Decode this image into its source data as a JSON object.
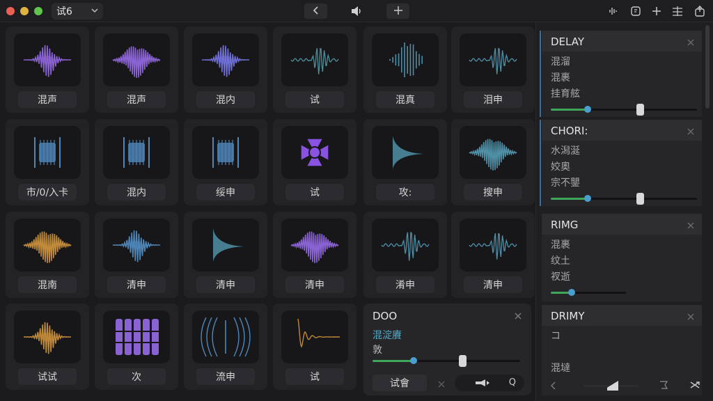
{
  "window": {
    "project_name": "试6",
    "toolbar": {
      "back": "back",
      "volume": "volume",
      "add": "add"
    }
  },
  "tiles": [
    {
      "label": "混声",
      "wave": "burst",
      "color": "#8a63d2"
    },
    {
      "label": "混声",
      "wave": "dense",
      "color": "#8a63d2"
    },
    {
      "label": "混内",
      "wave": "burst",
      "color": "#6f6fd8"
    },
    {
      "label": "试",
      "wave": "sparse",
      "color": "#4c8f9a"
    },
    {
      "label": "混真",
      "wave": "spike",
      "color": "#4f8fa6"
    },
    {
      "label": "泪申",
      "wave": "sparse",
      "color": "#4f8fa6"
    },
    {
      "label": "市/0/入卡",
      "wave": "block",
      "color": "#4f86b8"
    },
    {
      "label": "混内",
      "wave": "block",
      "color": "#4f86b8"
    },
    {
      "label": "绥申",
      "wave": "block",
      "color": "#4f86b8"
    },
    {
      "label": "试",
      "wave": "flower",
      "color": "#8a52e0"
    },
    {
      "label": "攻:",
      "wave": "decay",
      "color": "#4f8fa6"
    },
    {
      "label": "搜申",
      "wave": "dense",
      "color": "#4f8fa6"
    },
    {
      "label": "混南",
      "wave": "dense",
      "color": "#c08a3a"
    },
    {
      "label": "清申",
      "wave": "burst",
      "color": "#4f86b8"
    },
    {
      "label": "清申",
      "wave": "decay",
      "color": "#4f8fa6"
    },
    {
      "label": "清申",
      "wave": "dense",
      "color": "#8a63d2"
    },
    {
      "label": "淆申",
      "wave": "line",
      "color": "#4f8fa6"
    },
    {
      "label": "清申",
      "wave": "sparse",
      "color": "#4f8fa6"
    },
    {
      "label": "试试",
      "wave": "burst",
      "color": "#c08a3a"
    },
    {
      "label": "次",
      "wave": "bars",
      "color": "#8a63d2"
    },
    {
      "label": "流申",
      "wave": "arcs",
      "color": "#4f86b8"
    },
    {
      "label": "试",
      "wave": "ring",
      "color": "#c08a3a"
    }
  ],
  "doo_panel": {
    "title": "DOO",
    "param1": "混淀賡",
    "param2": "敦",
    "slider_fill": 0.28,
    "slider_handle": 0.61,
    "button": "试會",
    "pill_q": "Q"
  },
  "effects": [
    {
      "name": "DELAY",
      "options": [
        "混溜",
        "混裹",
        "挂育舷"
      ],
      "slider_fill": 0.25,
      "slider_handle": 0.61,
      "active": true
    },
    {
      "name": "CHORI:",
      "options": [
        "水潟涎",
        "姣奧",
        "宗不鑍"
      ],
      "slider_fill": 0.25,
      "slider_handle": 0.61,
      "active": true
    },
    {
      "name": "RIMG",
      "options": [
        "混裹",
        "纹土",
        "衩逝"
      ],
      "slider_fill": 0.28,
      "slider_handle": null,
      "active": false
    },
    {
      "name": "DRIMY",
      "options": [
        "コ",
        "",
        "混墶"
      ],
      "slider_fill": null,
      "slider_handle": null,
      "active": false
    }
  ],
  "colors": {
    "accent": "#3fa65a",
    "dot": "#4a9fd0",
    "link": "#54a9c4"
  }
}
